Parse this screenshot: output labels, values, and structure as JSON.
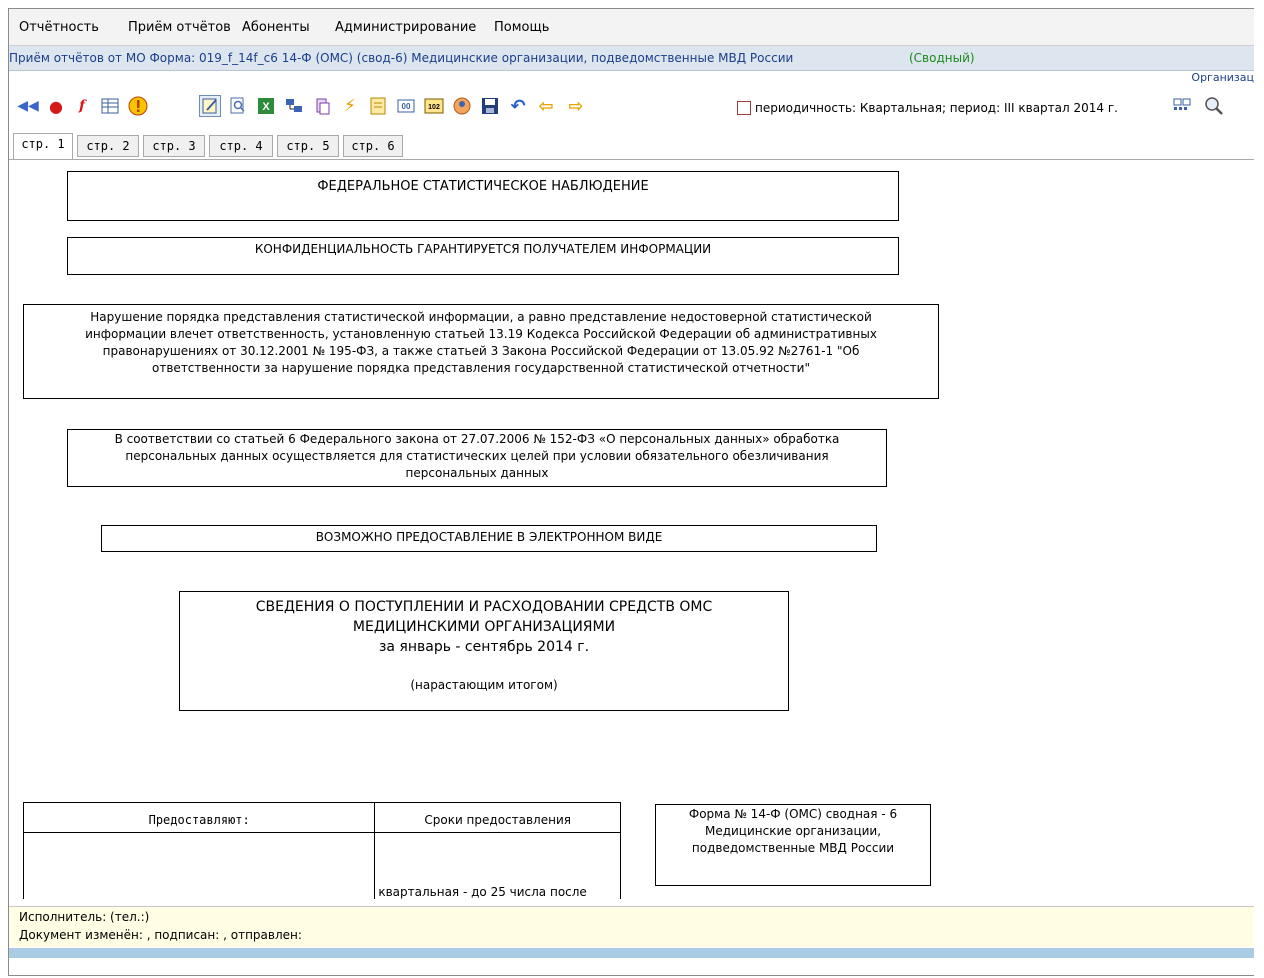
{
  "menu": [
    "Отчётность",
    "Приём отчётов",
    "Абоненты",
    "Администрирование",
    "Помощь"
  ],
  "title": {
    "main": "Приём отчётов от МО Форма: 019_f_14f_c6 14-Ф (ОМС) (свод-6) Медицинские организации, подведомственные МВД России",
    "status": "(Сводный)",
    "right_hint": "Организац"
  },
  "toolbar": {
    "icons": [
      "first-arrows-icon",
      "record-dot-icon",
      "function-icon",
      "table-icon",
      "warning-icon",
      "edit-note-icon",
      "search-doc-icon",
      "excel-icon",
      "network-icon",
      "paste-icon",
      "lightning-icon",
      "form-icon",
      "counter-icon",
      "code-102-icon",
      "user-icon",
      "save-icon",
      "undo-icon",
      "arrow-left-icon",
      "arrow-right-icon"
    ],
    "period_label": "периодичность: Квартальная; период: III квартал 2014 г.",
    "right_icons": [
      "grid-icon",
      "zoom-icon"
    ]
  },
  "tabs": [
    "стр. 1",
    "стр. 2",
    "стр. 3",
    "стр. 4",
    "стр. 5",
    "стр. 6"
  ],
  "doc": {
    "federal": "ФЕДЕРАЛЬНОЕ СТАТИСТИЧЕСКОЕ НАБЛЮДЕНИЕ",
    "confidential": "КОНФИДЕНЦИАЛЬНОСТЬ ГАРАНТИРУЕТСЯ ПОЛУЧАТЕЛЕМ ИНФОРМАЦИИ",
    "violation": [
      "Нарушение порядка представления статистической информации, а равно представление недостоверной статистической",
      "информации влечет ответственность, установленную статьей 13.19 Кодекса Российской Федерации  об административных",
      "правонарушениях от 30.12.2001 № 195-ФЗ, а также статьей 3 Закона Российской Федерации от 13.05.92  №2761-1 \"Об",
      "ответственности за нарушение  порядка представления государственной статистической отчетности\""
    ],
    "personal": [
      "В соответствии со статьей 6 Федерального закона от 27.07.2006 № 152-ФЗ «О персональных данных» обработка",
      "персональных данных осуществляется для статистических целей при условии обязательного обезличивания",
      "персональных данных"
    ],
    "electronic": "ВОЗМОЖНО ПРЕДОСТАВЛЕНИЕ В ЭЛЕКТРОННОМ ВИДЕ",
    "report_title": [
      "СВЕДЕНИЯ О ПОСТУПЛЕНИИ И РАСХОДОВАНИИ СРЕДСТВ ОМС",
      "МЕДИЦИНСКИМИ ОРГАНИЗАЦИЯМИ",
      "за январь - сентябрь 2014 г."
    ],
    "cumulative": "(нарастающим итогом)",
    "table": {
      "col1": "Предоставляют:",
      "col2": "Сроки предоставления",
      "col2_value": "квартальная - до 25 числа после"
    },
    "form_box": [
      "Форма № 14-Ф (ОМС) сводная - 6",
      "Медицинские организации,",
      "подведомственные МВД России"
    ]
  },
  "status": {
    "executor": "Исполнитель: (тел.:)",
    "changed": "Документ изменён: , подписан: , отправлен:"
  }
}
